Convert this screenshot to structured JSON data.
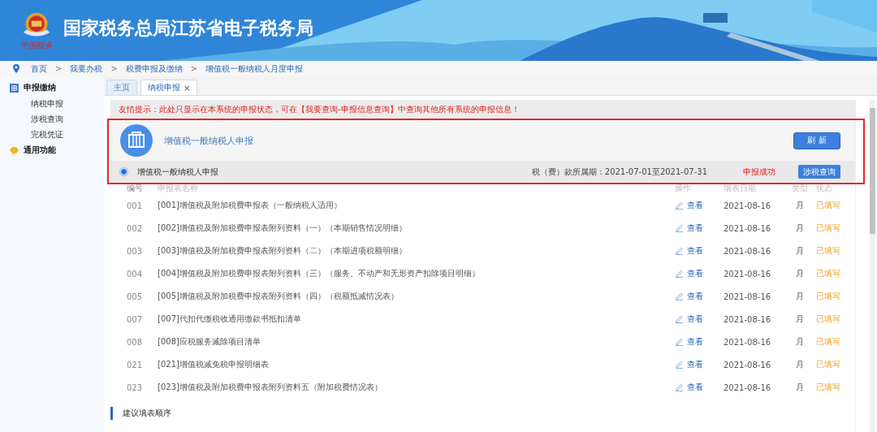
{
  "header": {
    "title": "国家税务总局江苏省电子税务局",
    "logo_caption": "中国税务"
  },
  "breadcrumb": [
    "首页",
    "我要办税",
    "税费申报及缴纳",
    "增值税一般纳税人月度申报"
  ],
  "breadcrumb_separator": ">",
  "sidebar": {
    "items": [
      {
        "label": "申报缴纳",
        "children": [
          {
            "label": "纳税申报"
          },
          {
            "label": "涉税查询"
          },
          {
            "label": "完税凭证"
          }
        ]
      },
      {
        "label": "通用功能"
      }
    ]
  },
  "tabs": [
    {
      "label": "主页",
      "selected": false
    },
    {
      "label": "纳税申报",
      "selected": true,
      "close": "×"
    }
  ],
  "notice": "友情提示：此处只显示在本系统的申报状态，可在【我要查询-申报信息查询】中查询其他所有系统的申报信息！",
  "declaration": {
    "title": "增值税一般纳税人申报",
    "refresh_button": "刷 新",
    "option": {
      "label": "增值税一般纳税人申报",
      "selected": true
    },
    "period": "税（费）款所属期：2021-07-01至2021-07-31",
    "result": "申报成功",
    "query_button": "涉税查询"
  },
  "table": {
    "columns": [
      "编号",
      "申报表名称",
      "操作",
      "填表日期",
      "类型",
      "状态"
    ],
    "rows": [
      {
        "code": "001",
        "name": "[001]增值税及附加税费申报表（一般纳税人适用）",
        "action": "查看",
        "date": "2021-08-16",
        "type": "月",
        "status": "已填写"
      },
      {
        "code": "002",
        "name": "[002]增值税及附加税费申报表附列资料（一）（本期销售情况明细）",
        "action": "查看",
        "date": "2021-08-16",
        "type": "月",
        "status": "已填写"
      },
      {
        "code": "003",
        "name": "[003]增值税及附加税费申报表附列资料（二）（本期进项税额明细）",
        "action": "查看",
        "date": "2021-08-16",
        "type": "月",
        "status": "已填写"
      },
      {
        "code": "004",
        "name": "[004]增值税及附加税费申报表附列资料（三）（服务、不动产和无形资产扣除项目明细）",
        "action": "查看",
        "date": "2021-08-16",
        "type": "月",
        "status": "已填写"
      },
      {
        "code": "005",
        "name": "[005]增值税及附加税费申报表附列资料（四）（税额抵减情况表）",
        "action": "查看",
        "date": "2021-08-16",
        "type": "月",
        "status": "已填写"
      },
      {
        "code": "007",
        "name": "[007]代扣代缴税收通用缴款书抵扣清单",
        "action": "查看",
        "date": "2021-08-16",
        "type": "月",
        "status": "已填写"
      },
      {
        "code": "008",
        "name": "[008]应税服务减除项目清单",
        "action": "查看",
        "date": "2021-08-16",
        "type": "月",
        "status": "已填写"
      },
      {
        "code": "021",
        "name": "[021]增值税减免税申报明细表",
        "action": "查看",
        "date": "2021-08-16",
        "type": "月",
        "status": "已填写"
      },
      {
        "code": "023",
        "name": "[023]增值税及附加税费申报表附列资料五（附加税费情况表）",
        "action": "查看",
        "date": "2021-08-16",
        "type": "月",
        "status": "已填写"
      }
    ]
  },
  "section_heading": "建议填表顺序"
}
